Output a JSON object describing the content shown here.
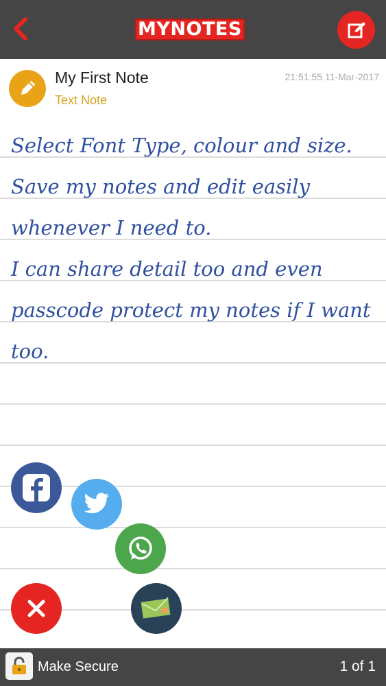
{
  "header": {
    "logo_text": "MYNOTES"
  },
  "note": {
    "title": "My First Note",
    "type": "Text Note",
    "timestamp": "21:51:55 11-Mar-2017",
    "body": "Select Font Type, colour and size.\nSave my notes and edit easily\nwhenever I need to.\nI can share detail too and even\npasscode protect my notes if I want\ntoo."
  },
  "share": {
    "icons": [
      "facebook-icon",
      "twitter-icon",
      "whatsapp-icon",
      "email-icon",
      "close-icon"
    ]
  },
  "footer": {
    "secure_label": "Make Secure",
    "page_count": "1 of 1"
  },
  "colors": {
    "header_bg": "#454545",
    "accent_red": "#e52521",
    "note_icon": "#e8a317",
    "note_type": "#d4a421",
    "note_text": "#2f4fa0",
    "facebook": "#3b5998",
    "twitter": "#55acee",
    "whatsapp": "#4ca64c",
    "email": "#2a4257"
  }
}
